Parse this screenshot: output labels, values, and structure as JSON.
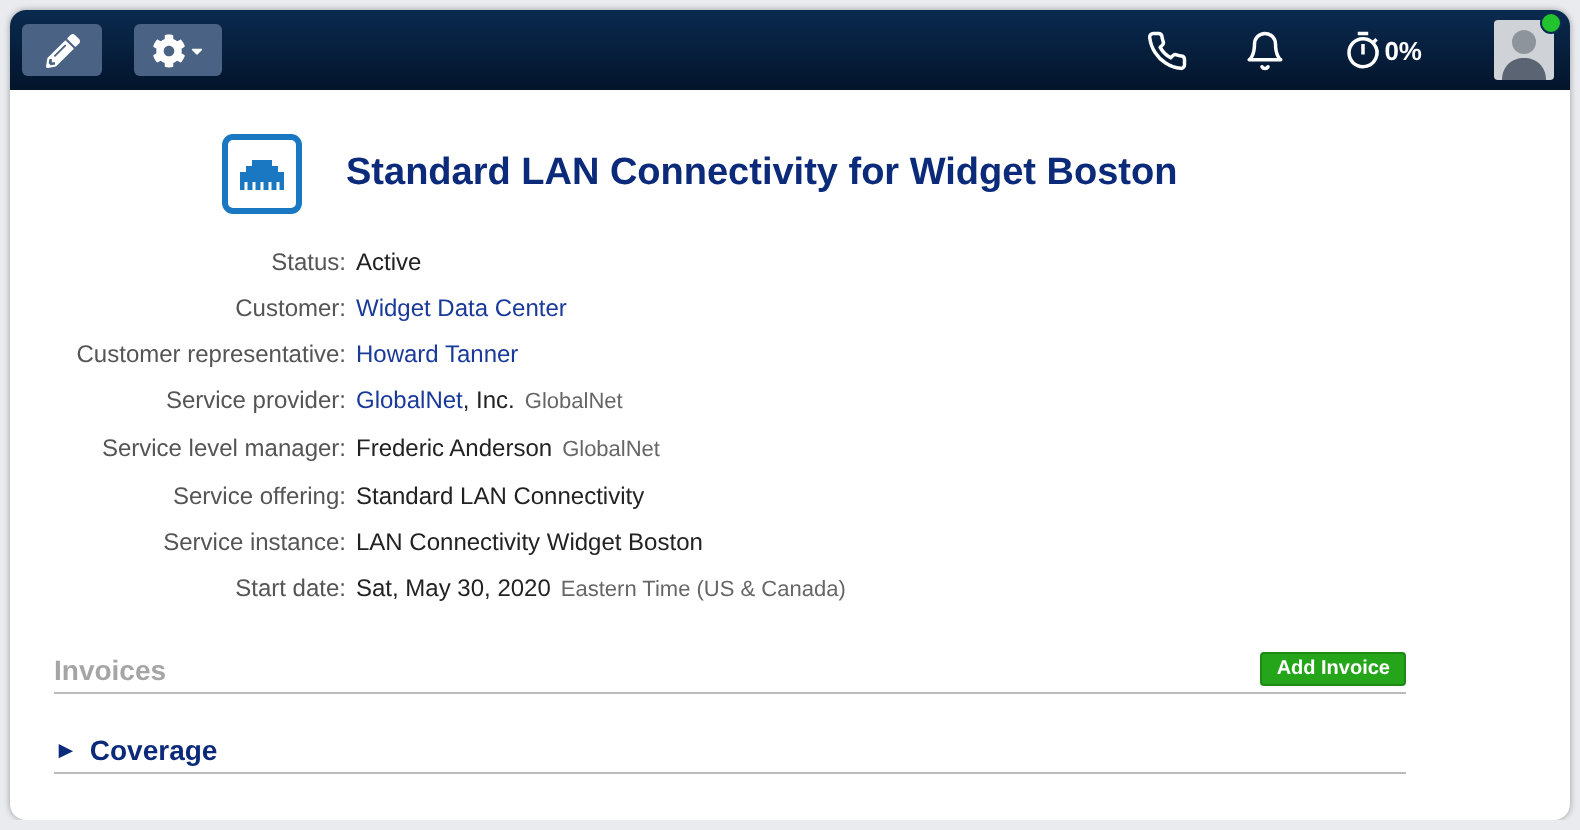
{
  "toolbar": {
    "progress": "0%",
    "user": {
      "online": true
    }
  },
  "service": {
    "title": "Standard LAN Connectivity for Widget Boston",
    "fields": [
      {
        "label": "Status:",
        "value": "Active",
        "kind": "plain"
      },
      {
        "label": "Customer:",
        "value": "Widget Data Center",
        "kind": "link"
      },
      {
        "label": "Customer representative:",
        "value": "Howard Tanner",
        "kind": "link"
      },
      {
        "label": "Service provider:",
        "value": "GlobalNet",
        "suffix": ", Inc.",
        "note": "GlobalNet",
        "kind": "link"
      },
      {
        "label": "Service level manager:",
        "value": "Frederic Anderson",
        "note": "GlobalNet",
        "kind": "plain"
      },
      {
        "label": "Service offering:",
        "value": "Standard LAN Connectivity",
        "kind": "plain"
      },
      {
        "label": "Service instance:",
        "value": "LAN Connectivity Widget Boston",
        "kind": "plain"
      },
      {
        "label": "Start date:",
        "value": "Sat, May 30, 2020",
        "note": "Eastern Time (US & Canada)",
        "kind": "plain"
      }
    ]
  },
  "sections": [
    {
      "title": "Invoices",
      "kind": "muted",
      "button": "Add Invoice"
    },
    {
      "title": "Coverage",
      "kind": "toggle",
      "toggle": "►",
      "expanded": false
    }
  ]
}
